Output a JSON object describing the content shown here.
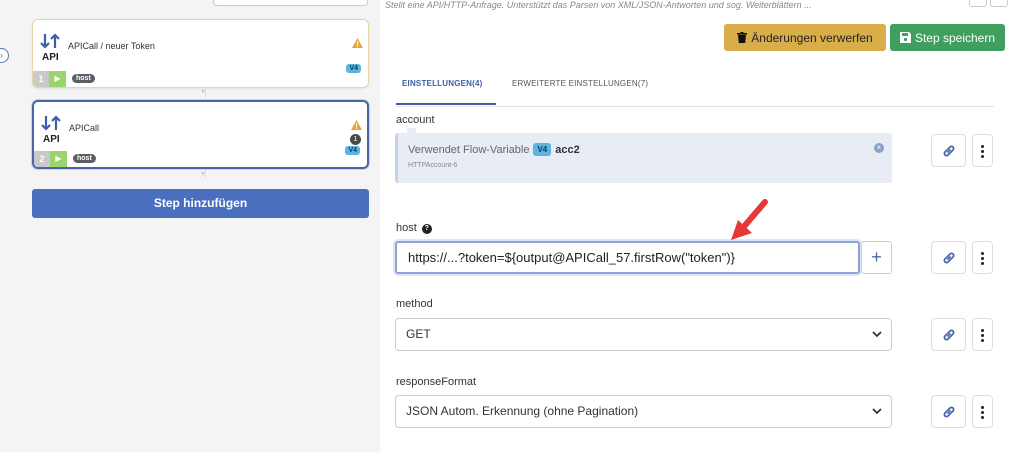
{
  "steps": [
    {
      "number": "1",
      "title": "APICall / neuer Token",
      "api_label": "API",
      "version": "V4",
      "tag": "host"
    },
    {
      "number": "2",
      "title": "APICall",
      "api_label": "API",
      "version": "V4",
      "tag": "host",
      "count": "1"
    }
  ],
  "add_step_label": "Step hinzufügen",
  "description": "Stellt eine API/HTTP-Anfrage. Unterstützt das Parsen von XML/JSON-Antworten und sog. Weiterblättern ...",
  "toolbar": {
    "discard_label": "Änderungen verwerfen",
    "save_label": "Step speichern"
  },
  "tabs": [
    {
      "label": "EINSTELLUNGEN(4)",
      "active": true
    },
    {
      "label": "ERWEITERTE EINSTELLUNGEN(7)",
      "active": false
    }
  ],
  "fields": {
    "account": {
      "label": "account",
      "prefix": "Verwendet Flow-Variable",
      "version": "V4",
      "value": "acc2",
      "sub": "HTTPAccount-6"
    },
    "host": {
      "label": "host",
      "value": "https://...?token=${output@APICall_57.firstRow(\"token\")}"
    },
    "method": {
      "label": "method",
      "value": "GET"
    },
    "responseFormat": {
      "label": "responseFormat",
      "value": "JSON Autom. Erkennung (ohne Pagination)"
    }
  },
  "colors": {
    "primary": "#4a6fbf",
    "discard": "#d9ae4a",
    "save": "#3f9f5f",
    "version_badge": "#5bb5e0",
    "warning": "#e8a33a",
    "annotation_arrow": "#e53935"
  }
}
